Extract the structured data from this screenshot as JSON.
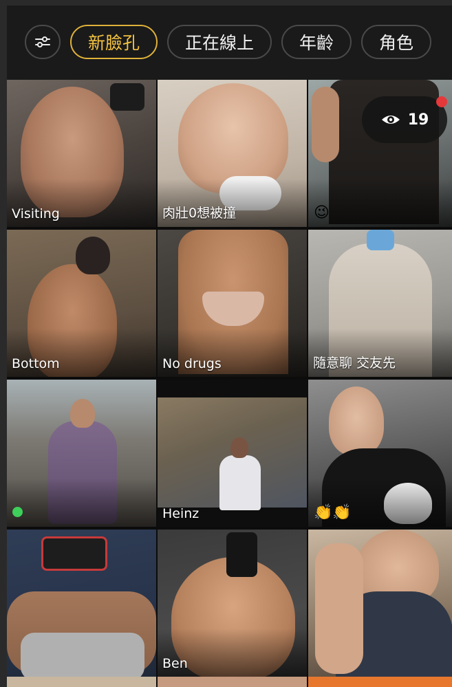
{
  "filters": {
    "settings_icon": "sliders-icon",
    "items": [
      {
        "label": "新臉孔",
        "active": true
      },
      {
        "label": "正在線上",
        "active": false
      },
      {
        "label": "年齡",
        "active": false
      },
      {
        "label": "角色",
        "active": false
      }
    ]
  },
  "viewers": {
    "icon": "eye-icon",
    "count": "19"
  },
  "profiles": [
    {
      "label": "Visiting"
    },
    {
      "label": "肉壯0想被撞"
    },
    {
      "label": "😉"
    },
    {
      "label": "Bottom"
    },
    {
      "label": "No drugs"
    },
    {
      "label": "隨意聊 交友先"
    },
    {
      "label": "",
      "status": "online"
    },
    {
      "label": "Heinz"
    },
    {
      "label": "👏👏"
    },
    {
      "label": ""
    },
    {
      "label": "Ben"
    },
    {
      "label": ""
    }
  ],
  "colors": {
    "accent": "#f3c241",
    "online": "#3ecf5a",
    "notification": "#e5383b"
  }
}
